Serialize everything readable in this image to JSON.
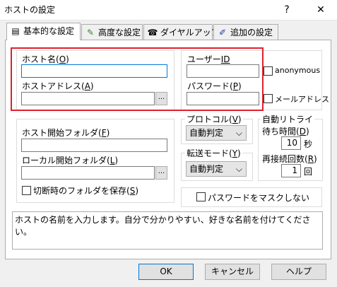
{
  "window": {
    "title": "ホストの設定",
    "help_btn": "?",
    "close_btn": "✕"
  },
  "tabs": [
    {
      "label": "基本的な設定",
      "icon": "document-icon"
    },
    {
      "label": "高度な設定",
      "icon": "pen-icon"
    },
    {
      "label": "ダイヤルアップ",
      "icon": "phone-icon"
    },
    {
      "label": "追加の設定",
      "icon": "brush-icon"
    }
  ],
  "host": {
    "name_label": "ホスト名(",
    "name_key": "O",
    "name_value": "",
    "address_label": "ホストアドレス(",
    "address_key": "A",
    "address_value": "",
    "browse_label": "..."
  },
  "user": {
    "id_label": "ユーザー",
    "id_key": "ID",
    "id_value": "",
    "pw_label": "パスワード(",
    "pw_key": "P",
    "pw_value": "",
    "anonymous_label": "anonymous",
    "mail_label": "メールアドレス"
  },
  "folders": {
    "host_label": "ホスト開始フォルダ(",
    "host_key": "F",
    "host_value": "",
    "local_label": "ローカル開始フォルダ(",
    "local_key": "L",
    "local_value": "",
    "browse_label": "...",
    "save_label": "切断時のフォルダを保存(",
    "save_key": "S"
  },
  "protocol": {
    "label": "プロトコル(",
    "key": "V",
    "value": "自動判定"
  },
  "transfer": {
    "label": "転送モード(",
    "key": "Y",
    "value": "自動判定"
  },
  "retry": {
    "group_label": "自動リトライ",
    "wait_label": "待ち時間(",
    "wait_key": "D",
    "wait_value": "10",
    "wait_unit": "秒",
    "count_label": "再接続回数(",
    "count_key": "R",
    "count_value": "1",
    "count_unit": "回"
  },
  "mask_label": "パスワードをマスクしない",
  "help_text": "ホストの名前を入力します。自分で分かりやすい、好きな名前を付けてください。",
  "buttons": {
    "ok": "OK",
    "cancel": "キャンセル",
    "help": "ヘルプ"
  },
  "colors": {
    "highlight": "#e0202e",
    "focus": "#0078d7"
  }
}
